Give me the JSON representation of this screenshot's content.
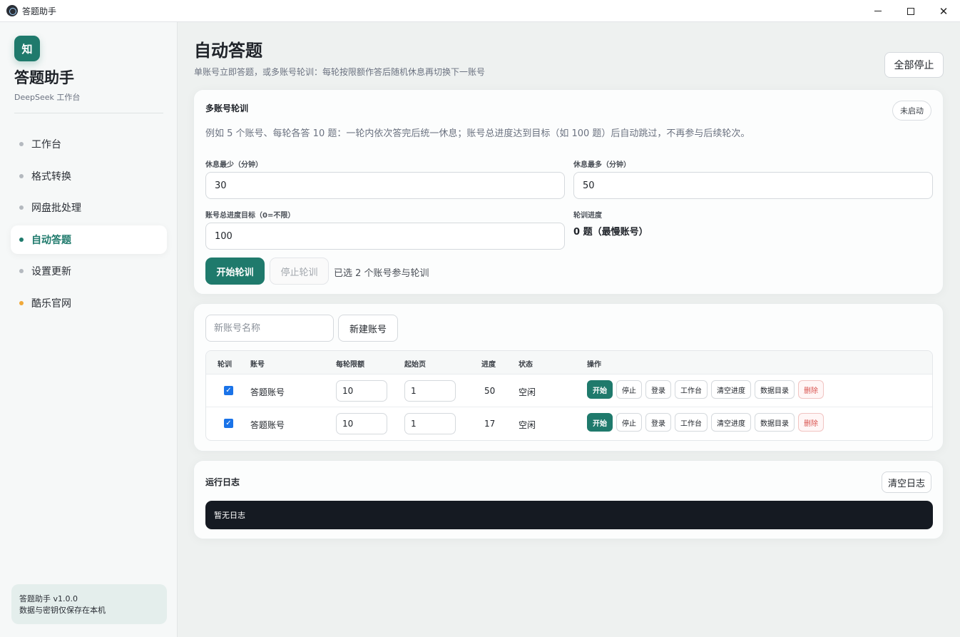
{
  "window": {
    "title": "答题助手",
    "controls": {
      "minimize": "minimize-icon",
      "maximize": "maximize-icon",
      "close": "close-icon"
    }
  },
  "sidebar": {
    "logo_text": "知",
    "app_name": "答题助手",
    "app_subtitle": "DeepSeek 工作台",
    "items": [
      {
        "label": "工作台",
        "active": false
      },
      {
        "label": "格式转换",
        "active": false
      },
      {
        "label": "网盘批处理",
        "active": false
      },
      {
        "label": "自动答题",
        "active": true
      },
      {
        "label": "设置更新",
        "active": false
      },
      {
        "label": "酷乐官网",
        "active": false,
        "external": true
      }
    ],
    "footer": {
      "version": "答题助手 v1.0.0",
      "note": "数据与密钥仅保存在本机"
    }
  },
  "header": {
    "title": "自动答题",
    "description": "单账号立即答题，或多账号轮训：每轮按限额作答后随机休息再切换下一账号",
    "stop_all_label": "全部停止"
  },
  "rotation": {
    "title": "多账号轮训",
    "status": "未启动",
    "hint": "例如 5 个账号、每轮各答 10 题：一轮内依次答完后统一休息；账号总进度达到目标（如 100 题）后自动跳过，不再参与后续轮次。",
    "rest_min_label": "休息最少（分钟）",
    "rest_min_value": "30",
    "rest_max_label": "休息最多（分钟）",
    "rest_max_value": "50",
    "target_label": "账号总进度目标（0=不限）",
    "target_value": "100",
    "progress_label": "轮训进度",
    "progress_value": "0 题（最慢账号）",
    "start_label": "开始轮训",
    "stop_label": "停止轮训",
    "selected_text": "已选 2 个账号参与轮训"
  },
  "accounts": {
    "new_name_placeholder": "新账号名称",
    "new_button_label": "新建账号",
    "columns": [
      "轮训",
      "账号",
      "每轮限额",
      "起始页",
      "进度",
      "状态",
      "操作"
    ],
    "action_labels": [
      "开始",
      "停止",
      "登录",
      "工作台",
      "清空进度",
      "数据目录",
      "删除"
    ],
    "rows": [
      {
        "checked": true,
        "name": "答题账号",
        "limit": "10",
        "start_page": "1",
        "progress": "50",
        "status": "空闲"
      },
      {
        "checked": true,
        "name": "答题账号",
        "limit": "10",
        "start_page": "1",
        "progress": "17",
        "status": "空闲"
      }
    ]
  },
  "log": {
    "title": "运行日志",
    "clear_label": "清空日志",
    "empty_text": "暂无日志"
  },
  "colors": {
    "accent": "#1f7a6c",
    "danger": "#d9534f",
    "log_bg": "#151a22",
    "external_dot": "#f0a93a",
    "checkbox": "#1a73e8"
  }
}
